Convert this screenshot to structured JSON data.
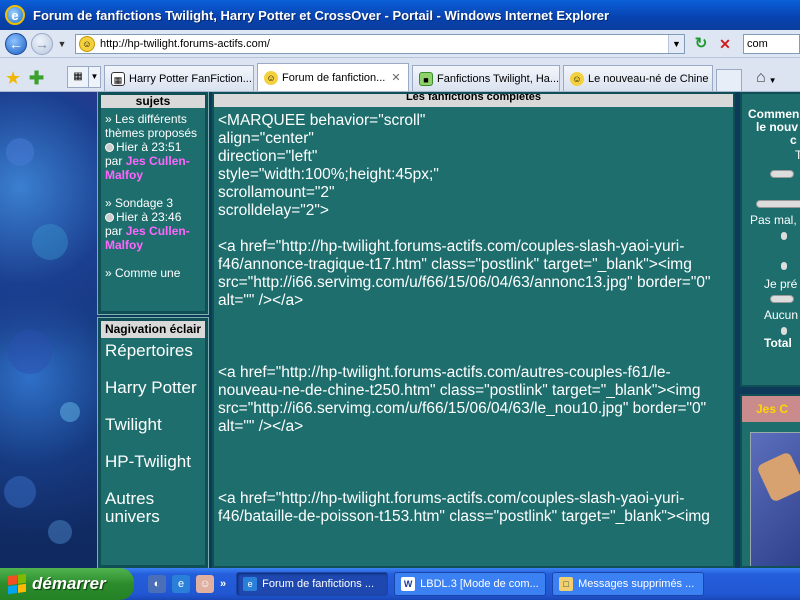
{
  "window": {
    "title": "Forum de fanfictions Twilight, Harry Potter et CrossOver - Portail - Windows Internet Explorer"
  },
  "address": {
    "url": "http://hp-twilight.forums-actifs.com/",
    "search_value": "com"
  },
  "tabs": [
    {
      "label": "Harry Potter FanFiction..."
    },
    {
      "label": "Forum de fanfiction...",
      "active": true
    },
    {
      "label": "Fanfictions Twilight, Ha..."
    },
    {
      "label": "Le nouveau-né de Chine"
    }
  ],
  "latest_topics": {
    "header": "sujets",
    "items": [
      {
        "title": "» Les différents thèmes proposés",
        "time": "Hier à 23:51",
        "by": "par",
        "author": "Jes Cullen-Malfoy"
      },
      {
        "title": "» Sondage 3",
        "time": "Hier à 23:46",
        "by": "par",
        "author": "Jes Cullen-Malfoy"
      },
      {
        "title": "» Comme une"
      }
    ]
  },
  "nav_module": {
    "header": "Nagivation éclair",
    "links": [
      "Répertoires",
      "Harry Potter",
      "Twilight",
      "HP-Twilight",
      "Autres univers"
    ]
  },
  "main": {
    "header": "Les fanfictions complètes",
    "code": "<MARQUEE behavior=\"scroll\"\nalign=\"center\"\ndirection=\"left\"\nstyle=\"width:100%;height:45px;\"\nscrollamount=\"2\"\nscrolldelay=\"2\">\n\n<a href=\"http://hp-twilight.forums-actifs.com/couples-slash-yaoi-yuri-f46/annonce-tragique-t17.htm\" class=\"postlink\" target=\"_blank\"><img src=\"http://i66.servimg.com/u/f66/15/06/04/63/annonc13.jpg\" border=\"0\" alt=\"\" /></a>\n\n\n\n<a href=\"http://hp-twilight.forums-actifs.com/autres-couples-f61/le-nouveau-ne-de-chine-t250.htm\" class=\"postlink\" target=\"_blank\"><img src=\"http://i66.servimg.com/u/f66/15/06/04/63/le_nou10.jpg\" border=\"0\" alt=\"\" /></a>\n\n\n\n<a href=\"http://hp-twilight.forums-actifs.com/couples-slash-yaoi-yuri-f46/bataille-de-poisson-t153.htm\" class=\"postlink\" target=\"_blank\"><img"
  },
  "poll": {
    "lines": [
      "Commen",
      "le nouv",
      "c"
    ],
    "t": "T",
    "option_mal": "Pas mal,",
    "option_pre": "Je pré",
    "option_aucun": "Aucun",
    "total": "Total"
  },
  "user_module": {
    "name": "Jes C"
  },
  "taskbar": {
    "start": "démarrer",
    "quicklaunch_more": "»",
    "tasks": [
      {
        "label": "Forum de fanfictions ...",
        "active": true
      },
      {
        "label": "LBDL.3 [Mode de com..."
      },
      {
        "label": "Messages supprimés ..."
      }
    ]
  }
}
